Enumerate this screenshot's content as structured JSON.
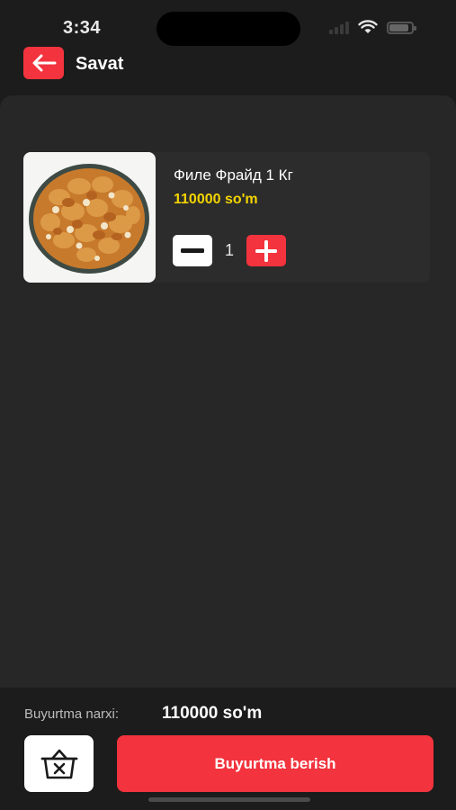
{
  "status_bar": {
    "time": "3:34",
    "icons": [
      "cellular-signal-icon",
      "wifi-icon",
      "battery-icon"
    ],
    "battery_level": 0.8
  },
  "header": {
    "back_icon": "arrow-left-icon",
    "title": "Savat"
  },
  "cart": {
    "items": [
      {
        "name": "Филе Фрайд 1 Кг",
        "price": "110000 so'm",
        "quantity": "1",
        "image": "fried-chicken-plate-photo"
      }
    ]
  },
  "footer": {
    "total_label": "Buyurtma narxi:",
    "total_value": "110000 so'm",
    "clear_icon": "basket-remove-icon",
    "order_label": "Buyurtma berish"
  },
  "colors": {
    "background": "#1c1c1c",
    "panel": "#272727",
    "accent": "#f3333d",
    "price": "#f3d400"
  }
}
